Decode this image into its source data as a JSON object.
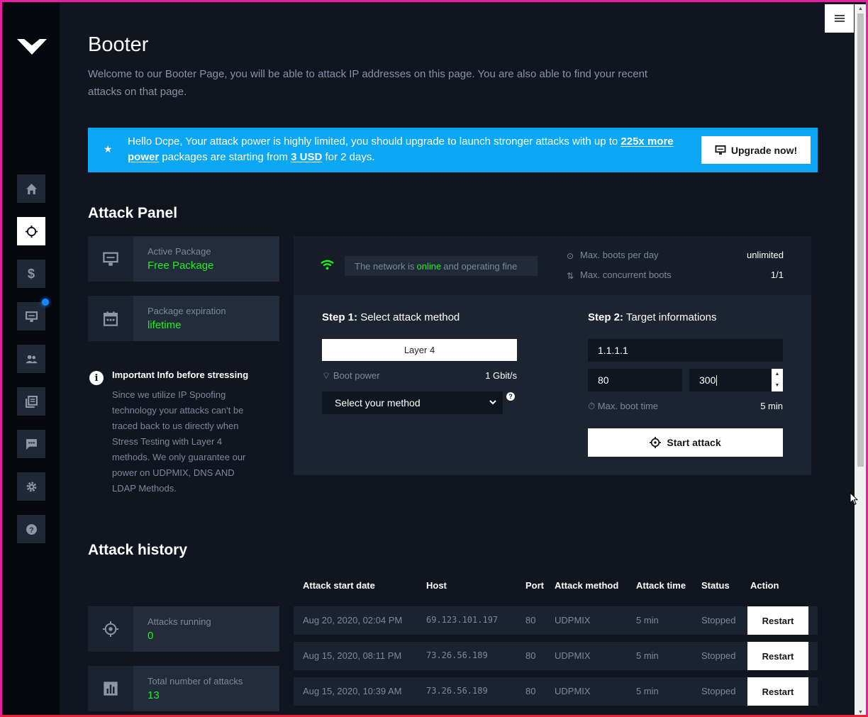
{
  "header": {
    "title": "Booter",
    "description": "Welcome to our Booter Page, you will be able to attack IP addresses on this page. You are also able to find your recent attacks on that page."
  },
  "banner": {
    "text_1": "Hello Dcpe, Your attack power is highly limited, you should upgrade to launch stronger attacks with up to",
    "link_power": "225x more power",
    "text_2": "packages are starting from",
    "link_price": "3 USD",
    "text_3": "for 2 days.",
    "upgrade_label": "Upgrade now!"
  },
  "sidebar": {
    "items": [
      {
        "name": "home",
        "icon": "home-icon"
      },
      {
        "name": "booter",
        "icon": "crosshair-icon",
        "active": true
      },
      {
        "name": "pricing",
        "icon": "dollar-icon"
      },
      {
        "name": "packages",
        "icon": "monitor-icon",
        "notification": true
      },
      {
        "name": "users",
        "icon": "users-icon"
      },
      {
        "name": "docs",
        "icon": "book-icon"
      },
      {
        "name": "chat",
        "icon": "chat-icon"
      },
      {
        "name": "settings",
        "icon": "gear-icon"
      },
      {
        "name": "help",
        "icon": "help-icon"
      }
    ]
  },
  "attack_panel": {
    "title": "Attack Panel",
    "active_package": {
      "label": "Active Package",
      "value": "Free Package"
    },
    "package_expiration": {
      "label": "Package expiration",
      "value": "lifetime"
    },
    "info": {
      "title": "Important Info before stressing",
      "text": "Since we utilize IP Spoofing technology your attacks can't be traced back to us directly when Stress Testing with Layer 4 methods. We only guarantee our power on UDPMIX, DNS AND LDAP Methods."
    },
    "network": {
      "prefix": "The network is",
      "status": "online",
      "suffix": "and operating fine"
    },
    "limits": {
      "max_boots_label": "Max. boots per day",
      "max_boots_value": "unlimited",
      "max_concurrent_label": "Max. concurrent boots",
      "max_concurrent_value": "1/1"
    },
    "step1": {
      "num": "Step 1:",
      "title": "Select attack method",
      "layer_label": "Layer 4",
      "boot_power_label": "Boot power",
      "boot_power_value": "1 Gbit/s",
      "method_placeholder": "Select your method",
      "help": "?"
    },
    "step2": {
      "num": "Step 2:",
      "title": "Target informations",
      "host_value": "1.1.1.1",
      "port_value": "80",
      "time_value": "300",
      "max_boot_time_label": "Max. boot time",
      "max_boot_time_value": "5 min",
      "start_label": "Start attack"
    }
  },
  "attack_history": {
    "title": "Attack history",
    "attacks_running": {
      "label": "Attacks running",
      "value": "0"
    },
    "total_attacks": {
      "label": "Total number of attacks",
      "value": "13"
    },
    "columns": [
      "Attack start date",
      "Host",
      "Port",
      "Attack method",
      "Attack time",
      "Status",
      "Action"
    ],
    "rows": [
      {
        "date": "Aug 20, 2020, 02:04 PM",
        "host": "69.123.101.197",
        "port": "80",
        "method": "UDPMIX",
        "time": "5 min",
        "status": "Stopped",
        "action": "Restart"
      },
      {
        "date": "Aug 15, 2020, 08:11 PM",
        "host": "73.26.56.189",
        "port": "80",
        "method": "UDPMIX",
        "time": "5 min",
        "status": "Stopped",
        "action": "Restart"
      },
      {
        "date": "Aug 15, 2020, 10:39 AM",
        "host": "73.26.56.189",
        "port": "80",
        "method": "UDPMIX",
        "time": "5 min",
        "status": "Stopped",
        "action": "Restart"
      }
    ]
  },
  "colors": {
    "accent_blue": "#0ba7f3",
    "online_green": "#1ef01e",
    "background": "#10151f"
  }
}
